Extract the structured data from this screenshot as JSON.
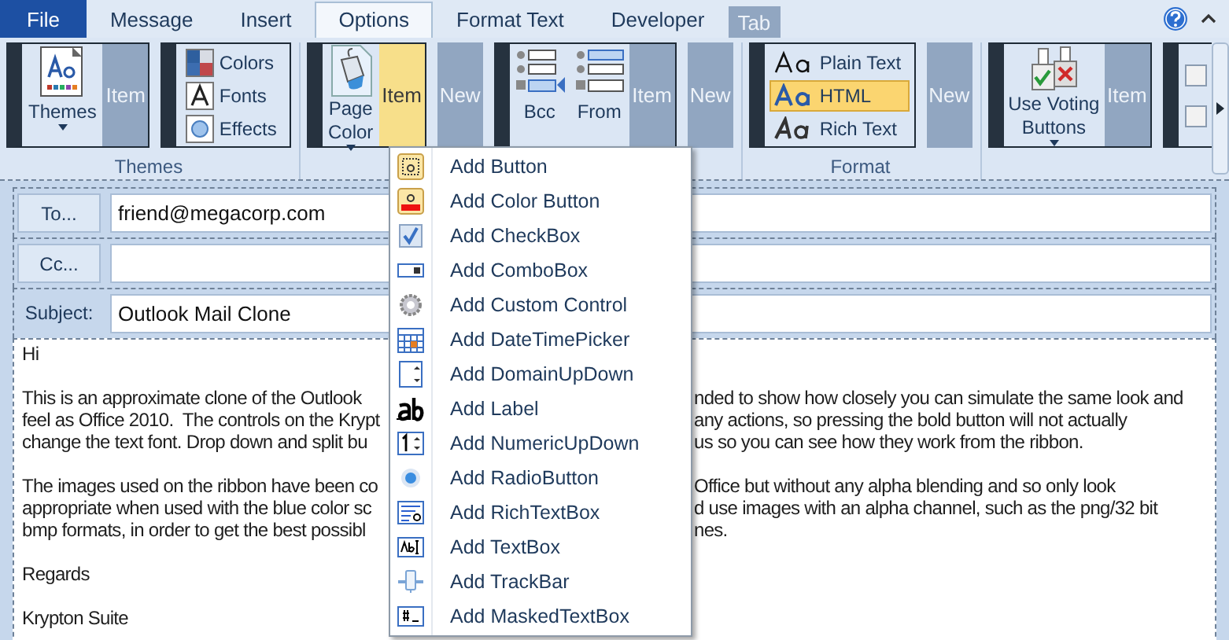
{
  "tabs": [
    {
      "label": "File",
      "kind": "file",
      "selected": false
    },
    {
      "label": "Message",
      "kind": "tab",
      "selected": false
    },
    {
      "label": "Insert",
      "kind": "tab",
      "selected": false
    },
    {
      "label": "Options",
      "kind": "tab",
      "selected": true
    },
    {
      "label": "Format Text",
      "kind": "tab",
      "selected": false
    },
    {
      "label": "Developer",
      "kind": "tab",
      "selected": false
    },
    {
      "label": "Tab",
      "kind": "context",
      "selected": false
    }
  ],
  "ribbon": {
    "groups": [
      {
        "label": "Themes",
        "parts": [
          {
            "kind": "panel",
            "controls": [
              {
                "kind": "themes",
                "label": "Themes",
                "dropdown": true
              },
              {
                "kind": "item",
                "label": "Item",
                "highlighted": false
              }
            ]
          },
          {
            "kind": "panel",
            "controls": [
              {
                "kind": "stack",
                "items": [
                  {
                    "kind": "colors",
                    "label": "Colors"
                  },
                  {
                    "kind": "fonts",
                    "label": "Fonts"
                  },
                  {
                    "kind": "effects",
                    "label": "Effects"
                  }
                ]
              }
            ]
          }
        ]
      },
      {
        "parts": [
          {
            "kind": "panel",
            "controls": [
              {
                "kind": "page-color",
                "label": "Page Color",
                "dropdown": true
              },
              {
                "kind": "item",
                "label": "Item",
                "highlighted": true
              }
            ]
          },
          {
            "kind": "new",
            "label": "New"
          },
          {
            "kind": "panel",
            "controls": [
              {
                "kind": "bcc",
                "label": "Bcc",
                "dropdown": false
              },
              {
                "kind": "from",
                "label": "From",
                "dropdown": false
              },
              {
                "kind": "item",
                "label": "Item",
                "highlighted": false
              }
            ]
          },
          {
            "kind": "new",
            "label": "New"
          }
        ]
      },
      {
        "label": "Format",
        "parts": [
          {
            "kind": "panel",
            "controls": [
              {
                "kind": "stack",
                "items": [
                  {
                    "kind": "plain",
                    "label": "Plain Text",
                    "selected": false
                  },
                  {
                    "kind": "html",
                    "label": "HTML",
                    "selected": true
                  },
                  {
                    "kind": "rich",
                    "label": "Rich Text",
                    "selected": false
                  }
                ]
              }
            ]
          },
          {
            "kind": "new",
            "label": "New"
          }
        ]
      },
      {
        "parts": [
          {
            "kind": "panel",
            "controls": [
              {
                "kind": "voting",
                "label": "Use Voting Buttons",
                "dropdown": true
              },
              {
                "kind": "item",
                "label": "Item",
                "highlighted": false
              }
            ]
          },
          {
            "kind": "panel",
            "controls": [
              {
                "kind": "checks",
                "items": [
                  {
                    "checked": false
                  },
                  {
                    "checked": false
                  }
                ]
              }
            ]
          }
        ]
      }
    ]
  },
  "form": {
    "fields": [
      {
        "kind": "button",
        "label": "To...",
        "value": "friend@megacorp.com"
      },
      {
        "kind": "button",
        "label": "Cc..."
      },
      {
        "kind": "label",
        "label": "Subject:",
        "value": "Outlook Mail Clone"
      }
    ]
  },
  "body": {
    "paragraphs": [
      {
        "lines": [
          {
            "left": "Hi"
          }
        ]
      },
      {
        "lines": [
          {
            "left": "This is an approximate clone of the Outlook",
            "right": "nded to show how closely you can simulate the same look and"
          },
          {
            "left": "feel as Office 2010.  The controls on the Krypt",
            "right": "any actions, so pressing the bold button will not actually"
          },
          {
            "left": "change the text font. Drop down and split bu",
            "right": "us so you can see how they work from the ribbon."
          }
        ]
      },
      {
        "lines": [
          {
            "left": "The images used on the ribbon have been co",
            "right": "Office but without any alpha blending and so only look"
          },
          {
            "left": "appropriate when used with the blue color sc",
            "right": "d use images with an alpha channel, such as the png/32 bit"
          },
          {
            "left": "bmp formats, in order to get the best possibl",
            "right": "nes."
          }
        ]
      },
      {
        "lines": [
          {
            "left": "Regards"
          }
        ]
      },
      {
        "lines": [
          {
            "left": "Krypton Suite"
          }
        ]
      }
    ]
  },
  "menu": {
    "items": [
      {
        "kind": "button",
        "label": "Add Button"
      },
      {
        "kind": "color-button",
        "label": "Add Color Button"
      },
      {
        "kind": "checkbox",
        "label": "Add CheckBox"
      },
      {
        "kind": "combobox",
        "label": "Add ComboBox"
      },
      {
        "kind": "custom",
        "label": "Add Custom Control"
      },
      {
        "kind": "datetime",
        "label": "Add DateTimePicker"
      },
      {
        "kind": "domain",
        "label": "Add DomainUpDown"
      },
      {
        "kind": "label",
        "label": "Add Label"
      },
      {
        "kind": "numeric",
        "label": "Add NumericUpDown"
      },
      {
        "kind": "radio",
        "label": "Add RadioButton"
      },
      {
        "kind": "richtext",
        "label": "Add RichTextBox"
      },
      {
        "kind": "textbox",
        "label": "Add TextBox"
      },
      {
        "kind": "trackbar",
        "label": "Add TrackBar"
      },
      {
        "kind": "masked",
        "label": "Add MaskedTextBox"
      }
    ]
  }
}
